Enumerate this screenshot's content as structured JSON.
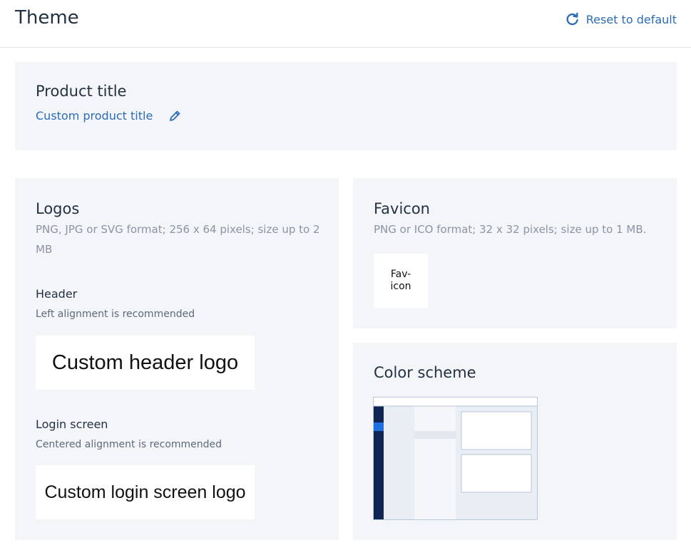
{
  "page": {
    "title": "Theme",
    "reset_label": "Reset to default"
  },
  "product_title": {
    "heading": "Product title",
    "value": "Custom product title",
    "edit_icon": "pencil-icon"
  },
  "logos": {
    "heading": "Logos",
    "format_hint": "PNG, JPG or SVG format; 256 x 64 pixels; size up to 2 MB",
    "header": {
      "label": "Header",
      "hint": "Left alignment is recommended",
      "preview_text": "Custom header logo"
    },
    "login": {
      "label": "Login screen",
      "hint": "Centered alignment is recommended",
      "preview_text": "Custom login screen logo"
    }
  },
  "favicon": {
    "heading": "Favicon",
    "format_hint": "PNG or ICO format; 32 x 32 pixels; size up to 1 MB.",
    "preview_text_line1": "Fav-",
    "preview_text_line2": "icon"
  },
  "color_scheme": {
    "heading": "Color scheme",
    "colors": {
      "navy": "#0e2452",
      "accent": "#1f6fe0",
      "panel": "#e9eef5",
      "content": "#f4f6f9"
    }
  },
  "colors": {
    "link": "#2b6cb8",
    "card_bg": "#f3f5f9"
  }
}
